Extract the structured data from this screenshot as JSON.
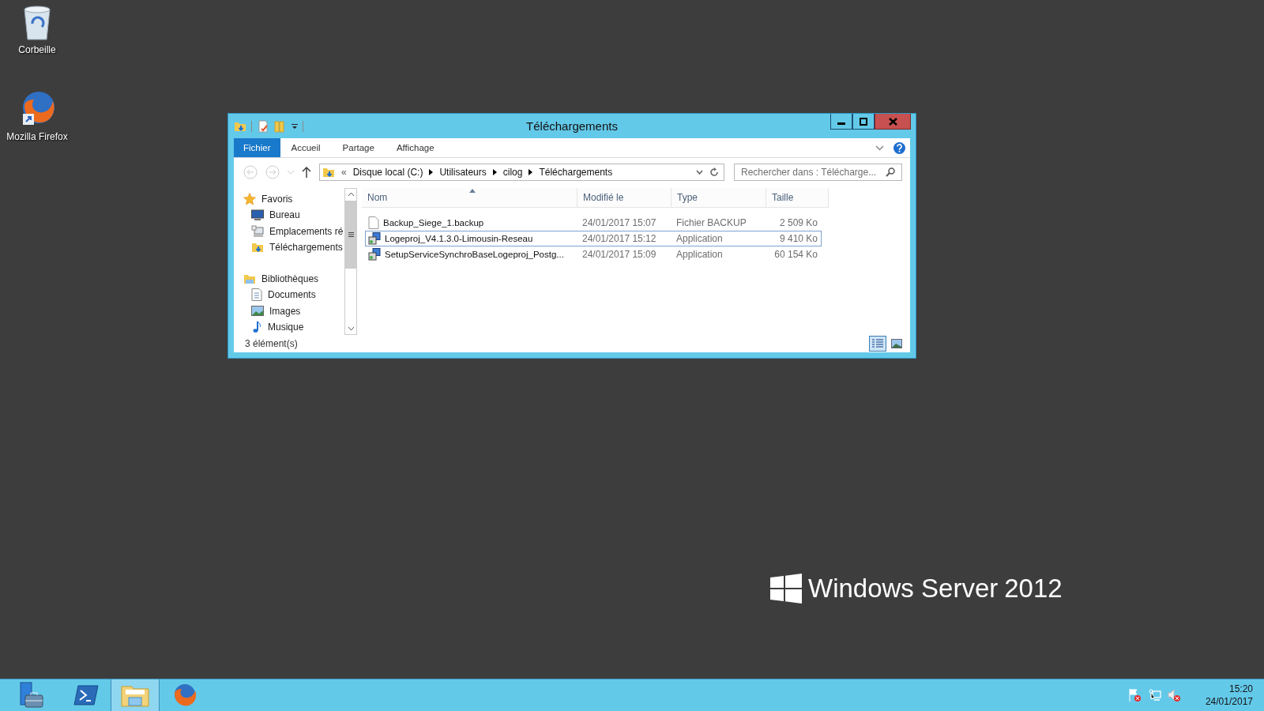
{
  "desktop_icons": [
    {
      "label": "Corbeille",
      "kind": "recycle-bin"
    },
    {
      "label": "Mozilla Firefox",
      "kind": "firefox"
    }
  ],
  "window": {
    "title": "Téléchargements",
    "ribbon_tabs": [
      {
        "label": "Fichier",
        "kind": "file-menu",
        "selected": false
      },
      {
        "label": "Accueil",
        "kind": "tab",
        "selected": false
      },
      {
        "label": "Partage",
        "kind": "tab",
        "selected": false
      },
      {
        "label": "Affichage",
        "kind": "tab",
        "selected": false
      }
    ],
    "address": {
      "overflow": "«",
      "segments": [
        "Disque local (C:)",
        "Utilisateurs",
        "cilog",
        "Téléchargements"
      ]
    },
    "search": {
      "placeholder": "Rechercher dans : Télécharge..."
    },
    "navigation": [
      {
        "label": "Favoris",
        "kind": "star",
        "children": [
          {
            "label": "Bureau",
            "kind": "desktop"
          },
          {
            "label": "Emplacements ré",
            "kind": "places"
          },
          {
            "label": "Téléchargements",
            "kind": "downloads"
          }
        ]
      },
      {
        "label": "Bibliothèques",
        "kind": "libraries",
        "children": [
          {
            "label": "Documents",
            "kind": "documents"
          },
          {
            "label": "Images",
            "kind": "images"
          },
          {
            "label": "Musique",
            "kind": "music"
          }
        ]
      }
    ],
    "columns": [
      {
        "label": "Nom",
        "sorted": true
      },
      {
        "label": "Modifié le",
        "sorted": false
      },
      {
        "label": "Type",
        "sorted": false
      },
      {
        "label": "Taille",
        "sorted": false
      }
    ],
    "files": [
      {
        "name": "Backup_Siege_1.backup",
        "modified": "24/01/2017 15:07",
        "type": "Fichier BACKUP",
        "size": "2 509 Ko",
        "kind": "document",
        "selected": false
      },
      {
        "name": "Logeproj_V4.1.3.0-Limousin-Reseau",
        "modified": "24/01/2017 15:12",
        "type": "Application",
        "size": "9 410 Ko",
        "kind": "installer",
        "selected": true
      },
      {
        "name": "SetupServiceSynchroBaseLogeproj_Postg...",
        "modified": "24/01/2017 15:09",
        "type": "Application",
        "size": "60 154 Ko",
        "kind": "installer",
        "selected": false
      }
    ],
    "status": "3 élément(s)",
    "views": [
      {
        "kind": "details",
        "selected": true
      },
      {
        "kind": "thumbnails",
        "selected": false
      }
    ]
  },
  "branding": {
    "product": "Windows Server",
    "version": "2012"
  },
  "taskbar": {
    "buttons": [
      {
        "kind": "server-manager",
        "selected": false
      },
      {
        "kind": "powershell",
        "selected": false
      },
      {
        "kind": "explorer",
        "selected": true
      },
      {
        "kind": "firefox",
        "selected": false
      }
    ],
    "time": "15:20",
    "date": "24/01/2017"
  }
}
